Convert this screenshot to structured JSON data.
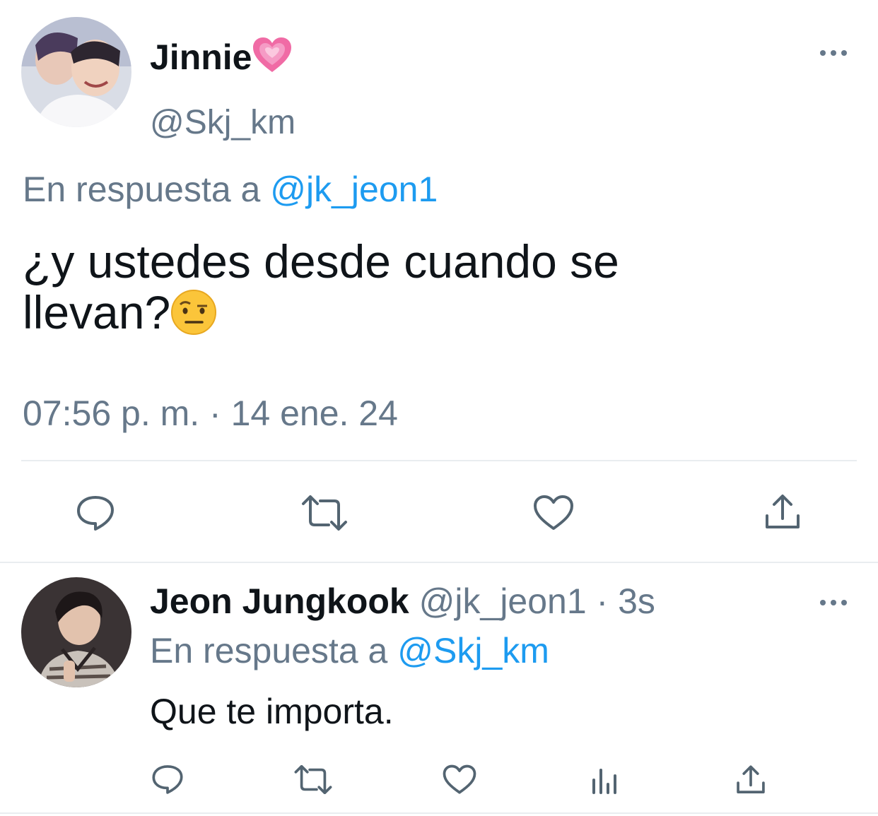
{
  "main_tweet": {
    "display_name": "Jinnie",
    "display_name_emoji": "growing-heart-emoji",
    "handle": "@Skj_km",
    "reply_prefix": "En respuesta a",
    "reply_to": "@jk_jeon1",
    "text_line1": "¿y ustedes desde cuando se",
    "text_line2": "llevan?",
    "text_emoji": "face-with-raised-eyebrow-emoji",
    "timestamp": "07:56 p. m. · 14 ene. 24",
    "actions": [
      "reply-icon",
      "retweet-icon",
      "like-icon",
      "share-icon"
    ]
  },
  "reply_tweet": {
    "display_name": "Jeon Jungkook",
    "handle_time": "@jk_jeon1 · 3s",
    "reply_prefix": "En respuesta a",
    "reply_to": "@Skj_km",
    "text": "Que te importa.",
    "actions": [
      "reply-icon",
      "retweet-icon",
      "like-icon",
      "views-icon",
      "share-icon"
    ]
  },
  "colors": {
    "text": "#0f1419",
    "muted": "#66788a",
    "link": "#1d9bf0",
    "divider": "#e9edf0",
    "heart": "#f06ba5"
  }
}
